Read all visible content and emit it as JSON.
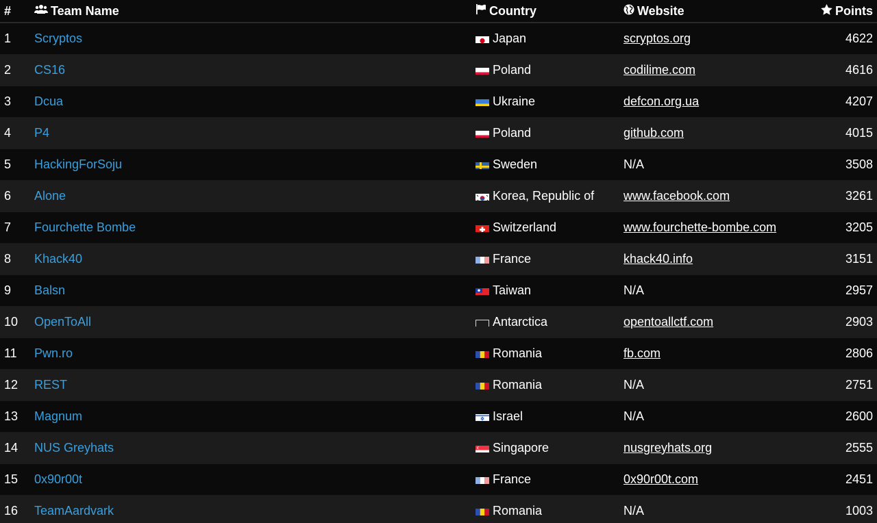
{
  "header": {
    "rank": "#",
    "team": "Team Name",
    "country": "Country",
    "website": "Website",
    "points": "Points",
    "team_icon": "users-icon",
    "country_icon": "flag-icon",
    "website_icon": "globe-icon",
    "points_icon": "star-icon"
  },
  "colors": {
    "team_link": "#3a9fdc",
    "row_dark": "#0b0b0b",
    "row_light": "#1c1c1c"
  },
  "rows": [
    {
      "rank": "1",
      "team": "Scryptos",
      "flag": "japan-flag-icon",
      "country": "Japan",
      "website": "scryptos.org",
      "points": "4622"
    },
    {
      "rank": "2",
      "team": "CS16",
      "flag": "poland-flag-icon",
      "country": "Poland",
      "website": "codilime.com",
      "points": "4616"
    },
    {
      "rank": "3",
      "team": "Dcua",
      "flag": "ukraine-flag-icon",
      "country": "Ukraine",
      "website": "defcon.org.ua",
      "points": "4207"
    },
    {
      "rank": "4",
      "team": "P4",
      "flag": "poland-flag-icon",
      "country": "Poland",
      "website": "github.com",
      "points": "4015"
    },
    {
      "rank": "5",
      "team": "HackingForSoju",
      "flag": "sweden-flag-icon",
      "country": "Sweden",
      "website": "N/A",
      "points": "3508"
    },
    {
      "rank": "6",
      "team": "Alone",
      "flag": "korea-flag-icon",
      "country": "Korea, Republic of",
      "website": "www.facebook.com",
      "points": "3261"
    },
    {
      "rank": "7",
      "team": "Fourchette Bombe",
      "flag": "switzerland-flag-icon",
      "country": "Switzerland",
      "website": "www.fourchette-bombe.com",
      "points": "3205"
    },
    {
      "rank": "8",
      "team": "Khack40",
      "flag": "france-flag-icon",
      "country": "France",
      "website": "khack40.info",
      "points": "3151"
    },
    {
      "rank": "9",
      "team": "Balsn",
      "flag": "taiwan-flag-icon",
      "country": "Taiwan",
      "website": "N/A",
      "points": "2957"
    },
    {
      "rank": "10",
      "team": "OpenToAll",
      "flag": "antarctica-flag-icon",
      "country": "Antarctica",
      "website": "opentoallctf.com",
      "points": "2903"
    },
    {
      "rank": "11",
      "team": "Pwn.ro",
      "flag": "romania-flag-icon",
      "country": "Romania",
      "website": "fb.com",
      "points": "2806"
    },
    {
      "rank": "12",
      "team": "REST",
      "flag": "romania-flag-icon",
      "country": "Romania",
      "website": "N/A",
      "points": "2751"
    },
    {
      "rank": "13",
      "team": "Magnum",
      "flag": "israel-flag-icon",
      "country": "Israel",
      "website": "N/A",
      "points": "2600"
    },
    {
      "rank": "14",
      "team": "NUS Greyhats",
      "flag": "singapore-flag-icon",
      "country": "Singapore",
      "website": "nusgreyhats.org",
      "points": "2555"
    },
    {
      "rank": "15",
      "team": "0x90r00t",
      "flag": "france-flag-icon",
      "country": "France",
      "website": "0x90r00t.com",
      "points": "2451"
    },
    {
      "rank": "16",
      "team": "TeamAardvark",
      "flag": "romania-flag-icon",
      "country": "Romania",
      "website": "N/A",
      "points": "1003"
    }
  ]
}
